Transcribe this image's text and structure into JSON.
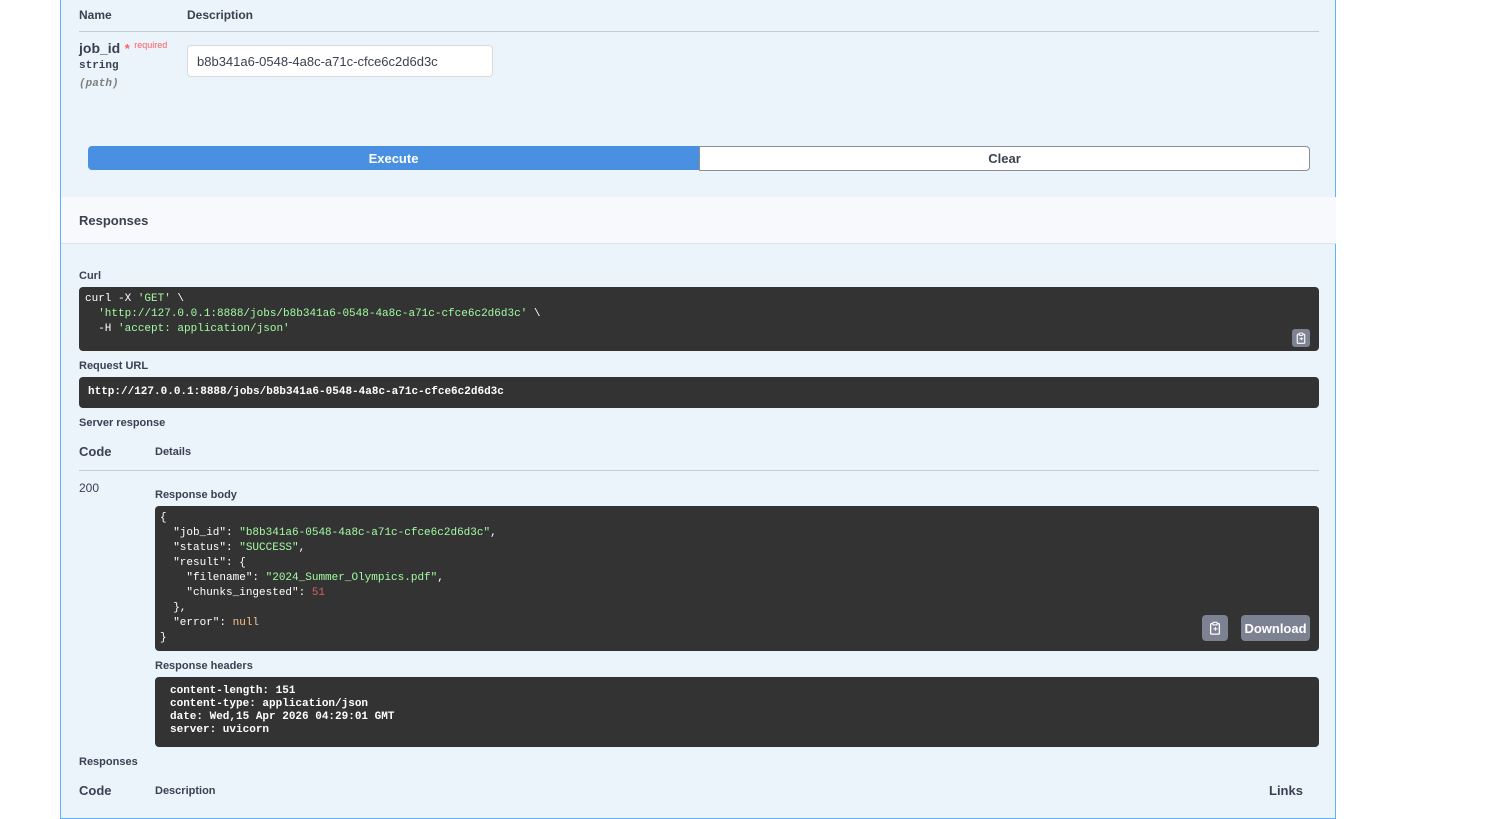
{
  "parameters": {
    "col_name": "Name",
    "col_description": "Description",
    "param": {
      "name": "job_id",
      "required_star": "*",
      "required_label": "required",
      "type": "string",
      "in": "(path)",
      "value": "b8b341a6-0548-4a8c-a71c-cfce6c2d6d3c"
    }
  },
  "actions": {
    "execute_label": "Execute",
    "clear_label": "Clear"
  },
  "responses_section_title": "Responses",
  "curl": {
    "label": "Curl",
    "line1_cmd": "curl -X ",
    "line1_method": "'GET'",
    "line1_tail": " \\",
    "line2_url": "'http://127.0.0.1:8888/jobs/b8b341a6-0548-4a8c-a71c-cfce6c2d6d3c'",
    "line2_tail": " \\",
    "line3_cmd": "  -H ",
    "line3_header": "'accept: application/json'"
  },
  "request_url": {
    "label": "Request URL",
    "value": "http://127.0.0.1:8888/jobs/b8b341a6-0548-4a8c-a71c-cfce6c2d6d3c"
  },
  "server_response": {
    "label": "Server response",
    "col_code": "Code",
    "col_details": "Details",
    "code": "200",
    "body_label": "Response body",
    "body": {
      "job_id": "b8b341a6-0548-4a8c-a71c-cfce6c2d6d3c",
      "status": "SUCCESS",
      "filename": "2024_Summer_Olympics.pdf",
      "chunks_ingested": "51",
      "error": "null"
    },
    "download_label": "Download",
    "headers_label": "Response headers",
    "headers": [
      "content-length: 151",
      "content-type: application/json",
      "date: Wed,15 Apr 2026 04:29:01 GMT",
      "server: uvicorn"
    ]
  },
  "responses_table": {
    "title": "Responses",
    "col_code": "Code",
    "col_description": "Description",
    "col_links": "Links"
  },
  "icons": [
    "clipboard-copy-icon"
  ]
}
